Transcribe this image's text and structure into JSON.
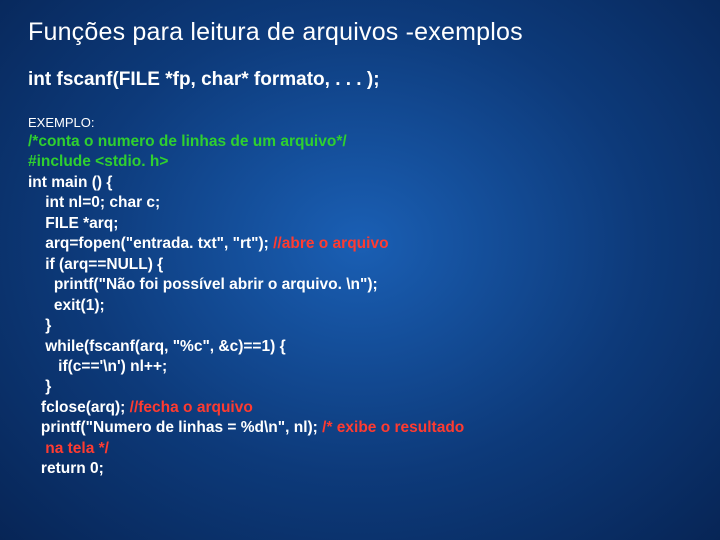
{
  "slide": {
    "title": "Funções para leitura de arquivos -exemplos",
    "signature": "int fscanf(FILE *fp, char* formato, . . . );",
    "example_label": "EXEMPLO:",
    "code": {
      "l1": "/*conta o numero de linhas de um arquivo*/",
      "l2": "#include <stdio. h>",
      "l3": "int main () {",
      "l4": "    int nl=0; char c;",
      "l5": "    FILE *arq;",
      "l6a": "    arq=fopen(\"entrada. txt\", \"rt\"); ",
      "l6b": "//abre o arquivo",
      "l7": "    if (arq==NULL) {",
      "l8": "      printf(\"Não foi possível abrir o arquivo. \\n\");",
      "l9": "      exit(1);",
      "l10": "    }",
      "l11": "    while(fscanf(arq, \"%c\", &c)==1) {",
      "l12": "       if(c=='\\n') nl++;",
      "l13": "    }",
      "l14a": "   fclose(arq); ",
      "l14b": "//fecha o arquivo",
      "l15a": "   printf(\"Numero de linhas = %d\\n\", nl); ",
      "l15b": "/* exibe o resultado",
      "l15c": "    na tela */",
      "l16": "   return 0;"
    }
  }
}
